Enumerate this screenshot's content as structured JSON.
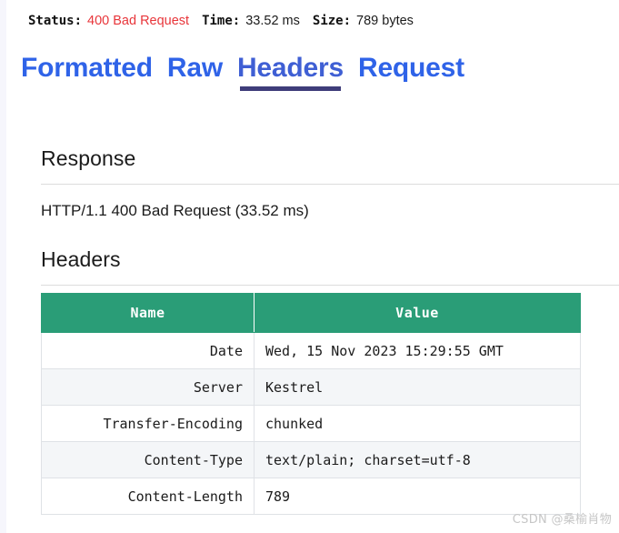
{
  "status_bar": {
    "status_label": "Status:",
    "status_value": "400 Bad Request",
    "status_color": "#e8353a",
    "time_label": "Time:",
    "time_value": "33.52 ms",
    "size_label": "Size:",
    "size_value": "789 bytes"
  },
  "tabs": [
    {
      "label": "Formatted",
      "active": false
    },
    {
      "label": "Raw",
      "active": false
    },
    {
      "label": "Headers",
      "active": true
    },
    {
      "label": "Request",
      "active": false
    }
  ],
  "tab_colors": {
    "inactive": "#2f63e8",
    "active_text": "#3f5fd4",
    "active_underline": "#3f3d7a"
  },
  "response_section": {
    "heading": "Response",
    "status_line": "HTTP/1.1 400 Bad Request (33.52 ms)"
  },
  "headers_section": {
    "heading": "Headers",
    "table": {
      "columns": [
        "Name",
        "Value"
      ],
      "header_bg": "#2a9d77",
      "rows": [
        {
          "name": "Date",
          "value": "Wed, 15 Nov 2023 15:29:55 GMT"
        },
        {
          "name": "Server",
          "value": "Kestrel"
        },
        {
          "name": "Transfer-Encoding",
          "value": "chunked"
        },
        {
          "name": "Content-Type",
          "value": "text/plain; charset=utf-8"
        },
        {
          "name": "Content-Length",
          "value": "789"
        }
      ]
    }
  },
  "watermark": {
    "text": "CSDN @桑榆肖物"
  }
}
